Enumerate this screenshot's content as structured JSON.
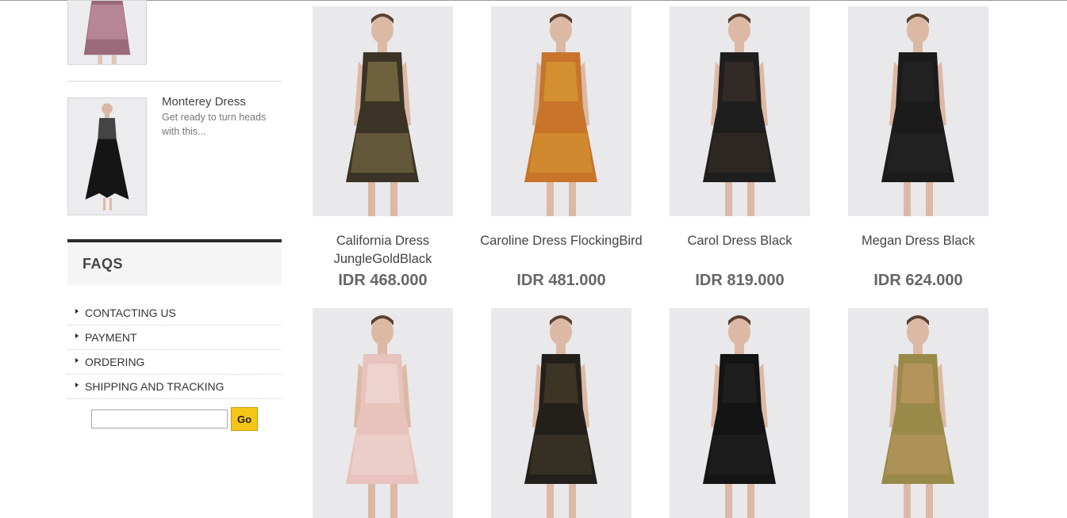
{
  "sidebar": {
    "recent_post": {
      "title": "Monterey Dress",
      "excerpt": "Get ready to turn heads with this..."
    },
    "faq": {
      "heading": "FAQS",
      "items": [
        "CONTACTING US",
        "PAYMENT",
        "ORDERING",
        "SHIPPING AND TRACKING"
      ]
    },
    "search": {
      "placeholder": "",
      "value": "",
      "button_label": "Go"
    }
  },
  "products": {
    "row1": [
      {
        "name": "California Dress JungleGoldBlack",
        "price": "IDR 468.000",
        "dress_color": "#3a3326",
        "accent_color": "#b09a5c"
      },
      {
        "name": "Caroline Dress FlockingBird",
        "price": "IDR 481.000",
        "dress_color": "#c8742a",
        "accent_color": "#e2b23a"
      },
      {
        "name": "Carol Dress Black",
        "price": "IDR 819.000",
        "dress_color": "#1e1e1e",
        "accent_color": "#4a3a30"
      },
      {
        "name": "Megan Dress Black",
        "price": "IDR 624.000",
        "dress_color": "#1b1b1b",
        "accent_color": "#2d2d2d"
      }
    ],
    "row2": [
      {
        "dress_color": "#e8c2bc",
        "accent_color": "#f4e6e2"
      },
      {
        "dress_color": "#23201c",
        "accent_color": "#5a5030"
      },
      {
        "dress_color": "#141414",
        "accent_color": "#2a2a2a"
      },
      {
        "dress_color": "#9a8a4a",
        "accent_color": "#d2a070"
      }
    ]
  },
  "colors": {
    "accent_button": "#f5c518",
    "faq_bar": "#2b2b2b",
    "price_text": "#666666"
  }
}
